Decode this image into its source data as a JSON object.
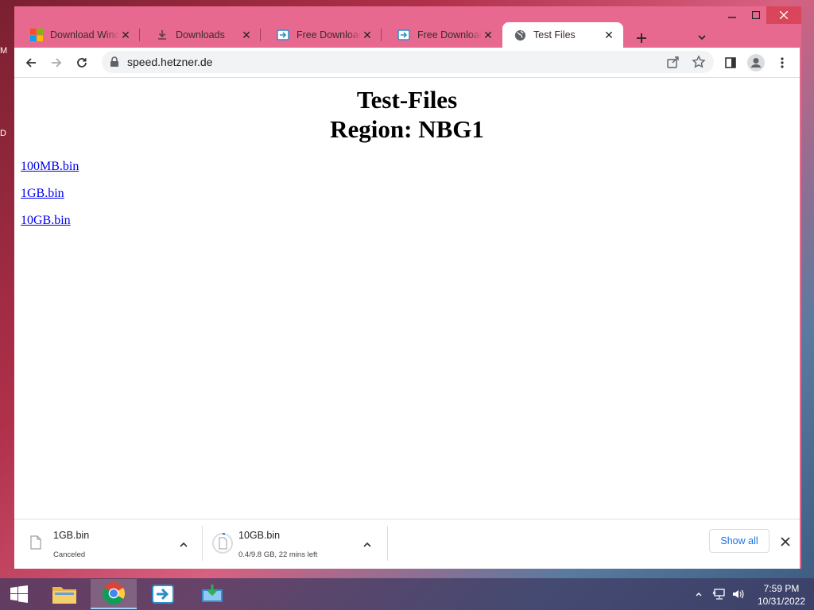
{
  "desktop": {
    "edge_letters": [
      "M",
      "D"
    ]
  },
  "browser": {
    "tabs": [
      {
        "label": "Download Wind",
        "icon": "windows-logo-icon"
      },
      {
        "label": "Downloads",
        "icon": "download-icon"
      },
      {
        "label": "Free Download I",
        "icon": "freedownload-app-icon"
      },
      {
        "label": "Free Download I",
        "icon": "freedownload-app-icon"
      },
      {
        "label": "Test Files",
        "icon": "globe-icon",
        "active": true
      }
    ],
    "url": "speed.hetzner.de"
  },
  "page": {
    "title_line1": "Test-Files",
    "title_line2": "Region: NBG1",
    "links": [
      "100MB.bin",
      "1GB.bin",
      "10GB.bin"
    ]
  },
  "downloads": {
    "items": [
      {
        "name": "1GB.bin",
        "status": "Canceled"
      },
      {
        "name": "10GB.bin",
        "status": "0.4/9.8 GB, 22 mins left",
        "progress_fraction": 0.04
      }
    ],
    "show_all_label": "Show all"
  },
  "taskbar": {
    "time": "7:59 PM",
    "date": "10/31/2022"
  },
  "colors": {
    "window_frame": "#e8698f",
    "link": "#0000ee",
    "show_all_text": "#1a73e8",
    "close_button": "#d9455a"
  }
}
